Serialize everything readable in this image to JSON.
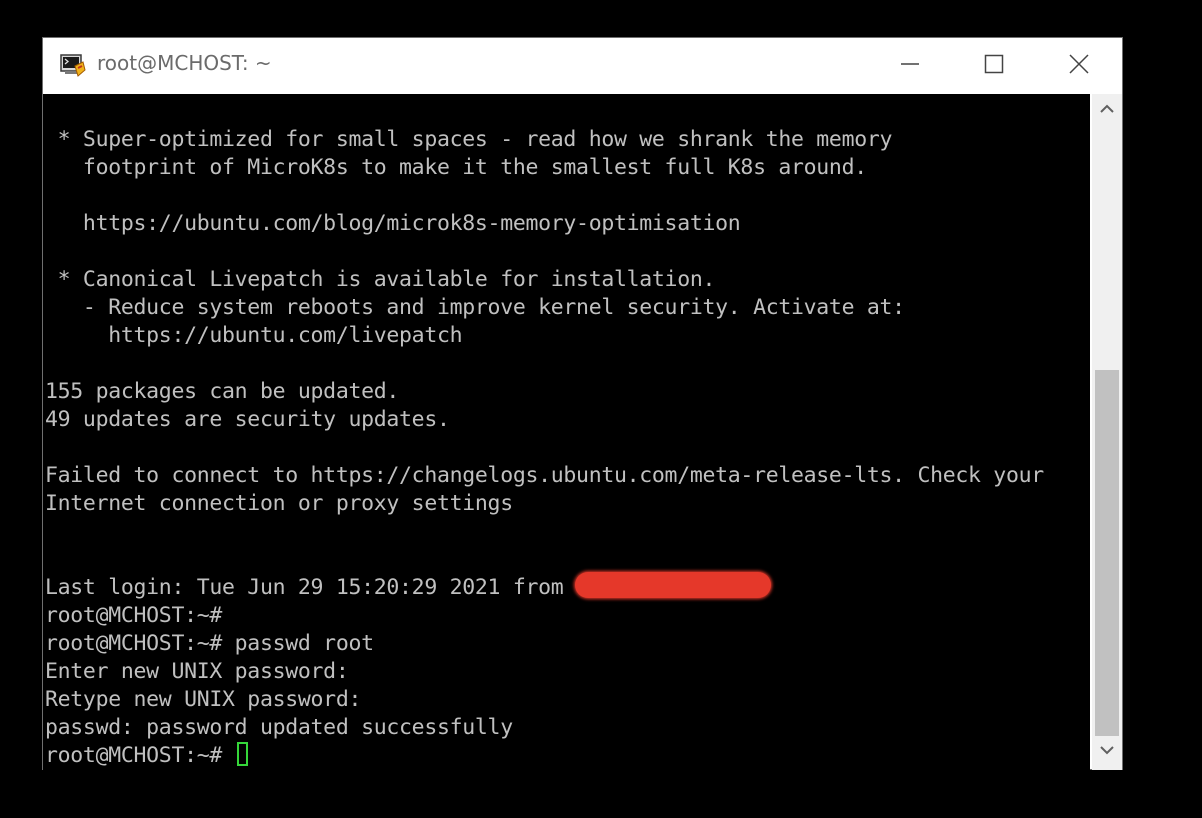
{
  "window": {
    "title": "root@MCHOST: ~",
    "icon": "putty-terminal-icon",
    "controls": [
      "minimize-icon",
      "maximize-icon",
      "close-icon"
    ]
  },
  "terminal": {
    "lines": [
      " * Super-optimized for small spaces - read how we shrank the memory",
      "   footprint of MicroK8s to make it the smallest full K8s around.",
      "",
      "   https://ubuntu.com/blog/microk8s-memory-optimisation",
      "",
      " * Canonical Livepatch is available for installation.",
      "   - Reduce system reboots and improve kernel security. Activate at:",
      "     https://ubuntu.com/livepatch",
      "",
      "155 packages can be updated.",
      "49 updates are security updates.",
      "",
      "Failed to connect to https://changelogs.ubuntu.com/meta-release-lts. Check your",
      "Internet connection or proxy settings",
      "",
      "",
      "Last login: Tue Jun 29 15:20:29 2021 from",
      "root@MCHOST:~#",
      "root@MCHOST:~# passwd root",
      "Enter new UNIX password:",
      "Retype new UNIX password:",
      "passwd: password updated successfully",
      "root@MCHOST:~# "
    ],
    "text_color": "#c0c0c0",
    "background": "#000000",
    "cursor_color": "#35d63a",
    "redaction_color": "#e5382a"
  },
  "scrollbar": {
    "up_icon": "chevron-up-icon",
    "down_icon": "chevron-down-icon"
  }
}
